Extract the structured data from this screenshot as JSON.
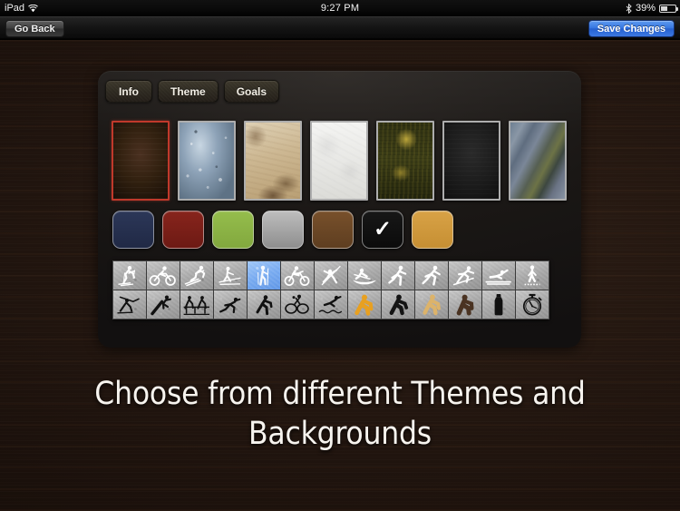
{
  "status_bar": {
    "carrier": "iPad",
    "wifi_icon": "wifi-icon",
    "time": "9:27 PM",
    "bluetooth_icon": "bluetooth-icon",
    "battery_percent": "39%",
    "battery_icon": "battery-icon"
  },
  "toolbar": {
    "back_label": "Go Back",
    "save_label": "Save Changes",
    "save_color": "#3877e0",
    "back_color": "#3e3e3e"
  },
  "panel": {
    "tabs": [
      {
        "label": "Info",
        "selected": false
      },
      {
        "label": "Theme",
        "selected": true
      },
      {
        "label": "Goals",
        "selected": false
      }
    ],
    "selection_border_color": "#c0392b",
    "backgrounds_label": "backgrounds",
    "backgrounds": [
      {
        "name": "dark-wood",
        "selected": true
      },
      {
        "name": "water-droplets",
        "selected": false
      },
      {
        "name": "beige-grunge",
        "selected": false
      },
      {
        "name": "white-marble",
        "selected": false
      },
      {
        "name": "olive-gold-grunge",
        "selected": false
      },
      {
        "name": "black-slate",
        "selected": false
      },
      {
        "name": "blue-green-blur",
        "selected": false
      }
    ],
    "colors": [
      {
        "name": "navy",
        "hex": "#26304f",
        "selected": false
      },
      {
        "name": "dark-red",
        "hex": "#7a2019",
        "selected": false
      },
      {
        "name": "green",
        "hex": "#8cb445",
        "selected": false
      },
      {
        "name": "silver",
        "hex": "#b2b2b2",
        "selected": false
      },
      {
        "name": "brown",
        "hex": "#6b4726",
        "selected": false
      },
      {
        "name": "black",
        "hex": "#121212",
        "selected": true
      },
      {
        "name": "gold",
        "hex": "#d09a3c",
        "selected": false
      }
    ],
    "check_glyph": "✓",
    "icons_row1": [
      {
        "name": "cross-country-skiing-icon",
        "selected": false
      },
      {
        "name": "cycling-icon",
        "selected": false
      },
      {
        "name": "downhill-skiing-icon",
        "selected": false
      },
      {
        "name": "ski-walking-icon",
        "selected": false
      },
      {
        "name": "hiking-icon",
        "selected": true
      },
      {
        "name": "mountain-biking-icon",
        "selected": false
      },
      {
        "name": "gymnastics-icon",
        "selected": false
      },
      {
        "name": "rowing-icon",
        "selected": false
      },
      {
        "name": "running-icon",
        "selected": false
      },
      {
        "name": "sprinting-icon",
        "selected": false
      },
      {
        "name": "snowboarding-icon",
        "selected": false
      },
      {
        "name": "swimming-icon",
        "selected": false
      },
      {
        "name": "walking-icon",
        "selected": false
      }
    ],
    "icons_row2": [
      {
        "name": "biathlon-icon",
        "selected": false
      },
      {
        "name": "baseball-icon",
        "selected": false
      },
      {
        "name": "hurdles-icon",
        "selected": false
      },
      {
        "name": "speed-skating-icon",
        "selected": false
      },
      {
        "name": "running-black-icon",
        "selected": false
      },
      {
        "name": "tennis-icon",
        "selected": false
      },
      {
        "name": "diving-icon",
        "selected": false
      },
      {
        "name": "runner-orange-icon",
        "selected": false
      },
      {
        "name": "runner-black-icon",
        "selected": false
      },
      {
        "name": "runner-gold-icon",
        "selected": false
      },
      {
        "name": "runner-brown-icon",
        "selected": false
      },
      {
        "name": "water-bottle-icon",
        "selected": false
      },
      {
        "name": "stopwatch-icon",
        "selected": false
      }
    ]
  },
  "tagline": "Choose from different Themes and Backgrounds"
}
